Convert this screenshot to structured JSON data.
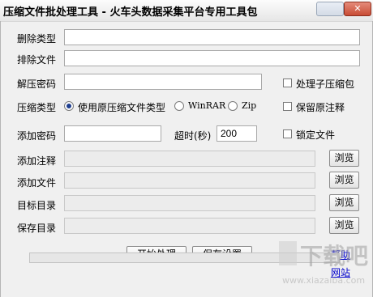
{
  "title": "压缩文件批处理工具 - 火车头数据采集平台专用工具包",
  "rows": {
    "delete_types": {
      "label": "删除类型",
      "value": ""
    },
    "exclude_files": {
      "label": "排除文件",
      "value": ""
    },
    "unzip_password": {
      "label": "解压密码",
      "value": ""
    },
    "compress_type": {
      "label": "压缩类型",
      "options": [
        "使用原压缩文件类型",
        "WinRAR",
        "Zip"
      ],
      "selected": "使用原压缩文件类型"
    },
    "add_password": {
      "label": "添加密码",
      "value": ""
    },
    "timeout": {
      "label": "超时(秒)",
      "value": "200"
    },
    "add_comment": {
      "label": "添加注释",
      "value": ""
    },
    "add_file": {
      "label": "添加文件",
      "value": ""
    },
    "target_dir": {
      "label": "目标目录",
      "value": ""
    },
    "save_dir": {
      "label": "保存目录",
      "value": ""
    }
  },
  "checkboxes": {
    "process_sub_archives": {
      "label": "处理子压缩包",
      "checked": false
    },
    "keep_comment": {
      "label": "保留原注释",
      "checked": false
    },
    "lock_file": {
      "label": "锁定文件",
      "checked": false
    }
  },
  "browse_label": "浏览",
  "buttons": {
    "start": "开始处理",
    "save_settings": "保存设置"
  },
  "links": {
    "help": "帮助",
    "website": "网站"
  },
  "progress_value": 0,
  "watermark_text": "下载吧",
  "watermark_url": "www.xiazaiba.com"
}
